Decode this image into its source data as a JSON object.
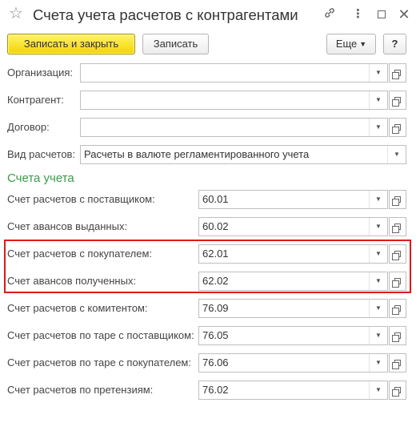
{
  "window": {
    "title": "Счета учета расчетов с контрагентами",
    "icons": [
      "star-icon",
      "link-icon",
      "more-icon",
      "maximize-icon",
      "close-icon"
    ]
  },
  "toolbar": {
    "save_close_label": "Записать и закрыть",
    "save_label": "Записать",
    "more_label": "Еще",
    "help_label": "?"
  },
  "main_fields": {
    "organization": {
      "label": "Организация:",
      "value": ""
    },
    "counterparty": {
      "label": "Контрагент:",
      "value": ""
    },
    "contract": {
      "label": "Договор:",
      "value": ""
    },
    "settlement_type": {
      "label": "Вид расчетов:",
      "value": "Расчеты в валюте регламентированного учета"
    }
  },
  "accounts": {
    "section_title": "Счета учета",
    "rows": [
      {
        "label": "Счет расчетов с поставщиком:",
        "value": "60.01"
      },
      {
        "label": "Счет авансов выданных:",
        "value": "60.02"
      },
      {
        "label": "Счет расчетов с покупателем:",
        "value": "62.01"
      },
      {
        "label": "Счет авансов полученных:",
        "value": "62.02"
      },
      {
        "label": "Счет расчетов с комитентом:",
        "value": "76.09"
      },
      {
        "label": "Счет расчетов по таре с поставщиком:",
        "value": "76.05"
      },
      {
        "label": "Счет расчетов по таре с покупателем:",
        "value": "76.06"
      },
      {
        "label": "Счет расчетов по претензиям:",
        "value": "76.02"
      }
    ]
  },
  "colors": {
    "primary_button": "#f2d500",
    "section_title": "#3a9b47",
    "highlight_border": "#e01818"
  }
}
